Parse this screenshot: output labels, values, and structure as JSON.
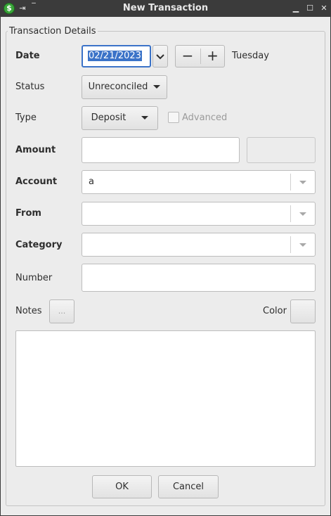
{
  "window": {
    "title": "New Transaction",
    "app_icon_glyph": "$",
    "pin_icon": "⇥",
    "minimize_icon": "▁",
    "maximize_icon": "☐",
    "close_icon": "✕"
  },
  "form": {
    "group_title": "Transaction Details",
    "date": {
      "label": "Date",
      "value": "02/21/2023",
      "weekday": "Tuesday",
      "minus_label": "−",
      "plus_label": "+"
    },
    "status": {
      "label": "Status",
      "value": "Unreconciled"
    },
    "type": {
      "label": "Type",
      "value": "Deposit"
    },
    "advanced": {
      "label": "Advanced",
      "checked": false
    },
    "amount": {
      "label": "Amount",
      "value": ""
    },
    "account": {
      "label": "Account",
      "value": "a"
    },
    "from": {
      "label": "From",
      "value": ""
    },
    "category": {
      "label": "Category",
      "value": ""
    },
    "number": {
      "label": "Number",
      "value": ""
    },
    "notes": {
      "label": "Notes",
      "button_label": "...",
      "value": ""
    },
    "color": {
      "label": "Color"
    }
  },
  "buttons": {
    "ok": "OK",
    "cancel": "Cancel"
  }
}
